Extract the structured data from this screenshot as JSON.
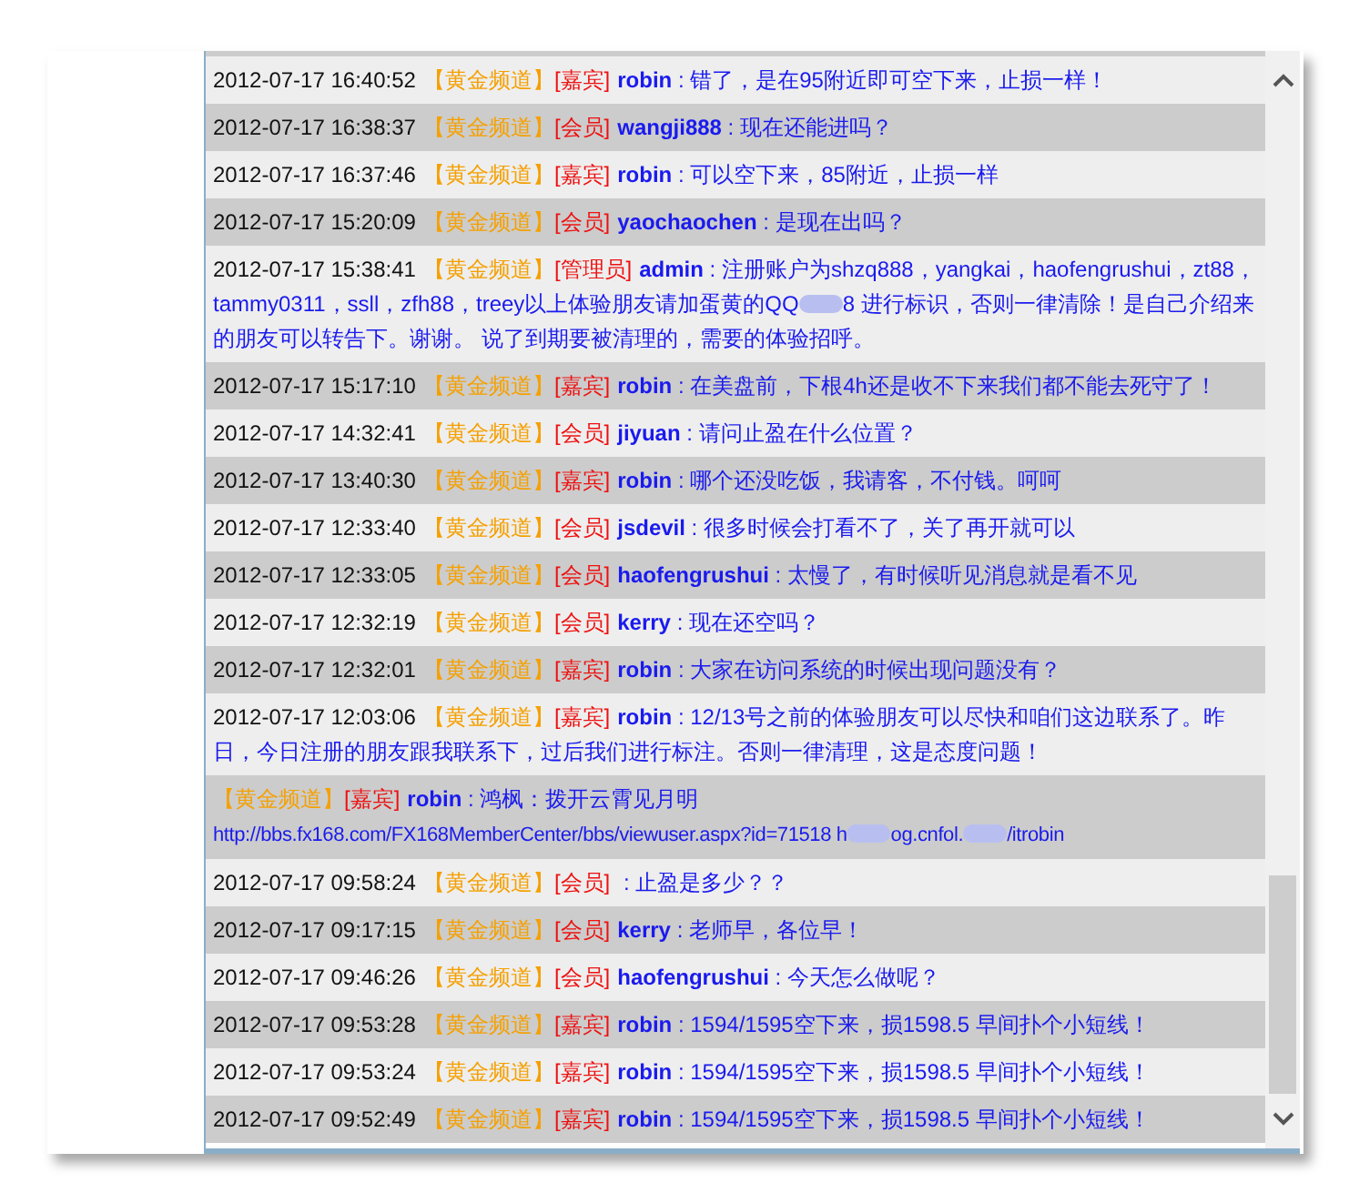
{
  "messages": [
    {
      "time": "2012-07-17 16:40:52",
      "channel": "【黄金频道】",
      "role": "[嘉宾]",
      "user": "robin",
      "separator": " : ",
      "message": [
        {
          "kind": "text",
          "text": "错了，是在95附近即可空下来，止损一样！"
        }
      ]
    },
    {
      "time": "2012-07-17 16:38:37",
      "channel": "【黄金频道】",
      "role": "[会员]",
      "user": "wangji888",
      "separator": " : ",
      "message": [
        {
          "kind": "text",
          "text": "现在还能进吗？"
        }
      ]
    },
    {
      "time": "2012-07-17 16:37:46",
      "channel": "【黄金频道】",
      "role": "[嘉宾]",
      "user": "robin",
      "separator": " : ",
      "message": [
        {
          "kind": "text",
          "text": "可以空下来，85附近，止损一样"
        }
      ]
    },
    {
      "time": "2012-07-17 15:20:09",
      "channel": "【黄金频道】",
      "role": "[会员]",
      "user": "yaochaochen",
      "separator": " : ",
      "message": [
        {
          "kind": "text",
          "text": "是现在出吗？"
        }
      ]
    },
    {
      "time": "2012-07-17 15:38:41",
      "channel": "【黄金频道】",
      "role": "[管理员]",
      "user": "admin",
      "separator": " : ",
      "message": [
        {
          "kind": "text",
          "text": "注册账户为shzq888，yangkai，haofengrushui，zt88，tammy0311，ssll，zfh88，treey以上体验朋友请加蛋黄的QQ"
        },
        {
          "kind": "blur"
        },
        {
          "kind": "text",
          "text": "8 进行标识，否则一律清除！是自己介绍来的朋友可以转告下。谢谢。 说了到期要被清理的，需要的体验招呼。"
        }
      ]
    },
    {
      "time": "2012-07-17 15:17:10",
      "channel": "【黄金频道】",
      "role": "[嘉宾]",
      "user": "robin",
      "separator": " : ",
      "message": [
        {
          "kind": "text",
          "text": "在美盘前，下根4h还是收不下来我们都不能去死守了！"
        }
      ]
    },
    {
      "time": "2012-07-17 14:32:41",
      "channel": "【黄金频道】",
      "role": "[会员]",
      "user": "jiyuan",
      "separator": " : ",
      "message": [
        {
          "kind": "text",
          "text": "请问止盈在什么位置？"
        }
      ]
    },
    {
      "time": "2012-07-17 13:40:30",
      "channel": "【黄金频道】",
      "role": "[嘉宾]",
      "user": "robin",
      "separator": " : ",
      "message": [
        {
          "kind": "text",
          "text": "哪个还没吃饭，我请客，不付钱。呵呵"
        }
      ]
    },
    {
      "time": "2012-07-17 12:33:40",
      "channel": "【黄金频道】",
      "role": "[会员]",
      "user": "jsdevil",
      "separator": " : ",
      "message": [
        {
          "kind": "text",
          "text": "很多时候会打看不了，关了再开就可以"
        }
      ]
    },
    {
      "time": "2012-07-17 12:33:05",
      "channel": "【黄金频道】",
      "role": "[会员]",
      "user": "haofengrushui",
      "separator": " : ",
      "message": [
        {
          "kind": "text",
          "text": "太慢了，有时候听见消息就是看不见"
        }
      ]
    },
    {
      "time": "2012-07-17 12:32:19",
      "channel": "【黄金频道】",
      "role": "[会员]",
      "user": "kerry",
      "separator": " : ",
      "message": [
        {
          "kind": "text",
          "text": "现在还空吗？"
        }
      ]
    },
    {
      "time": "2012-07-17 12:32:01",
      "channel": "【黄金频道】",
      "role": "[嘉宾]",
      "user": "robin",
      "separator": " : ",
      "message": [
        {
          "kind": "text",
          "text": "大家在访问系统的时候出现问题没有？"
        }
      ]
    },
    {
      "time": "2012-07-17 12:03:06",
      "channel": "【黄金频道】",
      "role": "[嘉宾]",
      "user": "robin",
      "separator": " : ",
      "message": [
        {
          "kind": "text",
          "text": "12/13号之前的体验朋友可以尽快和咱们这边联系了。昨日，今日注册的朋友跟我联系下，过后我们进行标注。否则一律清理，这是态度问题！"
        }
      ]
    },
    {
      "channel": "【黄金频道】",
      "role": "[嘉宾]",
      "user": "robin",
      "separator": " : ",
      "message": [
        {
          "kind": "text",
          "text": "鸿枫：拨开云霄见月明"
        },
        {
          "kind": "break"
        },
        {
          "kind": "link",
          "text": "http://bbs.fx168.com/FX168MemberCenter/bbs/viewuser.aspx?id=71518 h"
        },
        {
          "kind": "blur"
        },
        {
          "kind": "link",
          "text": "og.cnfol."
        },
        {
          "kind": "blur"
        },
        {
          "kind": "link",
          "text": "/itrobin"
        }
      ]
    },
    {
      "time": "2012-07-17 09:58:24",
      "channel": "【黄金频道】",
      "role": "[会员]",
      "separator": " : ",
      "message": [
        {
          "kind": "text",
          "text": "止盈是多少？？"
        }
      ]
    },
    {
      "time": "2012-07-17 09:17:15",
      "channel": "【黄金频道】",
      "role": "[会员]",
      "user": "kerry",
      "separator": " : ",
      "message": [
        {
          "kind": "text",
          "text": "老师早，各位早！"
        }
      ]
    },
    {
      "time": "2012-07-17 09:46:26",
      "channel": "【黄金频道】",
      "role": "[会员]",
      "user": "haofengrushui",
      "separator": " : ",
      "message": [
        {
          "kind": "text",
          "text": "今天怎么做呢？"
        }
      ]
    },
    {
      "time": "2012-07-17 09:53:28",
      "channel": "【黄金频道】",
      "role": "[嘉宾]",
      "user": "robin",
      "separator": " : ",
      "message": [
        {
          "kind": "text",
          "text": "1594/1595空下来，损1598.5 早间扑个小短线！"
        }
      ]
    },
    {
      "time": "2012-07-17 09:53:24",
      "channel": "【黄金频道】",
      "role": "[嘉宾]",
      "user": "robin",
      "separator": " : ",
      "message": [
        {
          "kind": "text",
          "text": "1594/1595空下来，损1598.5 早间扑个小短线！"
        }
      ]
    },
    {
      "time": "2012-07-17 09:52:49",
      "channel": "【黄金频道】",
      "role": "[嘉宾]",
      "user": "robin",
      "separator": " : ",
      "message": [
        {
          "kind": "text",
          "text": "1594/1595空下来，损1598.5 早间扑个小短线！"
        }
      ]
    }
  ]
}
